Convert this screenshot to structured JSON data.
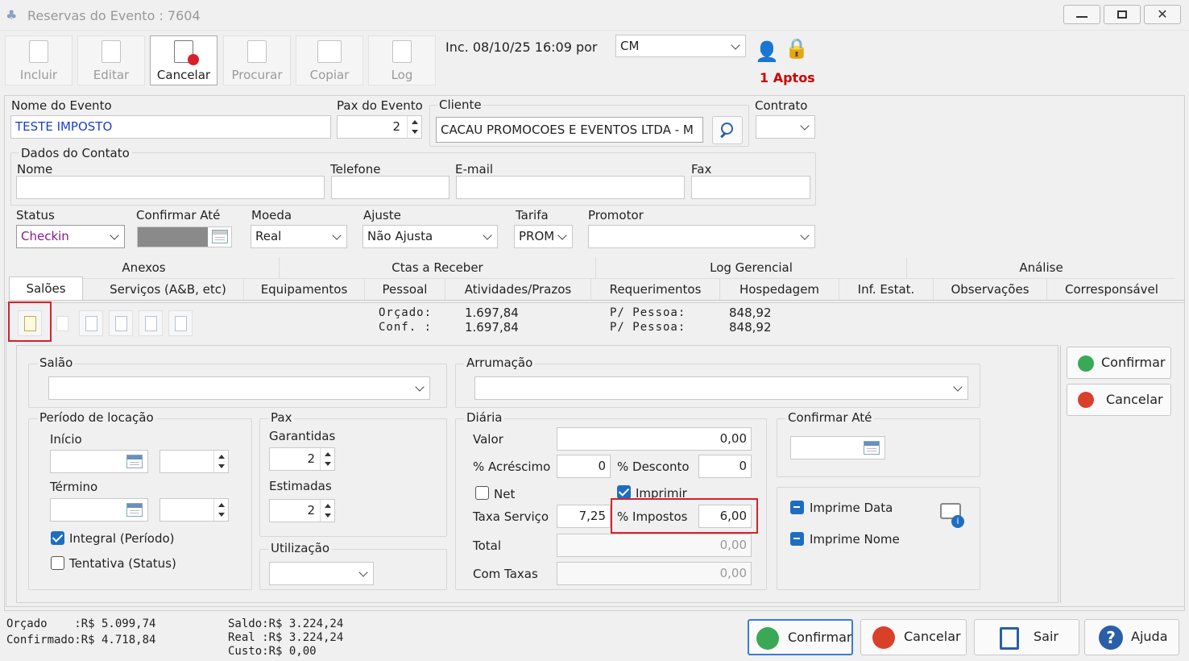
{
  "window": {
    "title": "Reservas do Evento : 7604"
  },
  "toolbar": {
    "incluir": "Incluir",
    "editar": "Editar",
    "cancelar": "Cancelar",
    "procurar": "Procurar",
    "copiar": "Copiar",
    "log": "Log"
  },
  "inc_info": "Inc. 08/10/25 16:09 por",
  "user_select": "CM",
  "aptos": "1 Aptos",
  "form": {
    "nome_evento_label": "Nome do Evento",
    "nome_evento": "TESTE IMPOSTO",
    "pax_label": "Pax do Evento",
    "pax": "2",
    "cliente_label": "Cliente",
    "cliente": "CACAU PROMOCOES E EVENTOS LTDA - M",
    "contrato_label": "Contrato",
    "contrato": "",
    "dados_contato": "Dados do Contato",
    "nome_label": "Nome",
    "telefone_label": "Telefone",
    "email_label": "E-mail",
    "fax_label": "Fax",
    "status_label": "Status",
    "status": "Checkin",
    "confirmar_ate_label": "Confirmar Até",
    "moeda_label": "Moeda",
    "moeda": "Real",
    "ajuste_label": "Ajuste",
    "ajuste": "Não Ajusta",
    "tarifa_label": "Tarifa",
    "tarifa": "PROM",
    "promotor_label": "Promotor",
    "promotor": ""
  },
  "tabs_row1": [
    "Anexos",
    "Ctas a Receber",
    "Log Gerencial",
    "Análise"
  ],
  "tabs_row2": [
    "Salões",
    "Serviços (A&B, etc)",
    "Equipamentos",
    "Pessoal",
    "Atividades/Prazos",
    "Requerimentos",
    "Hospedagem",
    "Inf. Estat.",
    "Observações",
    "Corresponsável"
  ],
  "summary": {
    "orcado_label": "Orçado:",
    "conf_label": "Conf. :",
    "orcado": "1.697,84",
    "conf": "1.697,84",
    "pp_label": "P/ Pessoa:",
    "pp1": "848,92",
    "pp2": "848,92"
  },
  "salao": {
    "salao_label": "Salão",
    "arrumacao_label": "Arrumação",
    "periodo_label": "Período de locação",
    "inicio_label": "Início",
    "termino_label": "Término",
    "integral_label": "Integral (Período)",
    "tentativa_label": "Tentativa (Status)",
    "pax_label": "Pax",
    "garantidas_label": "Garantidas",
    "garantidas": "2",
    "estimadas_label": "Estimadas",
    "estimadas": "2",
    "utilizacao_label": "Utilização",
    "diaria_label": "Diária",
    "valor_label": "Valor",
    "valor": "0,00",
    "acrescimo_label": "% Acréscimo",
    "acrescimo": "0",
    "desconto_label": "% Desconto",
    "desconto": "0",
    "net_label": "Net",
    "imprimir_label": "Imprimir",
    "taxa_label": "Taxa Serviço",
    "taxa": "7,25",
    "impostos_label": "% Impostos",
    "impostos": "6,00",
    "total_label": "Total",
    "total": "0,00",
    "comtaxas_label": "Com Taxas",
    "comtaxas": "0,00",
    "confirmar_ate_label": "Confirmar Até",
    "imprime_data": "Imprime Data",
    "imprime_nome": "Imprime Nome",
    "confirmar": "Confirmar",
    "cancelar": "Cancelar"
  },
  "footer": {
    "orcado": "Orçado    :R$ 5.099,74",
    "confirmado": "Confirmado:R$ 4.718,84",
    "saldo": "Saldo:R$ 3.224,24",
    "real": "Real :R$ 3.224,24",
    "custo": "Custo:R$ 0,00",
    "confirmar": "Confirmar",
    "cancelar": "Cancelar",
    "sair": "Sair",
    "ajuda": "Ajuda"
  },
  "colors": {
    "highlight": "#d9202a",
    "blue_text": "#1a3fd0",
    "aptos": "#d10000",
    "status": "#8a1a8a"
  }
}
